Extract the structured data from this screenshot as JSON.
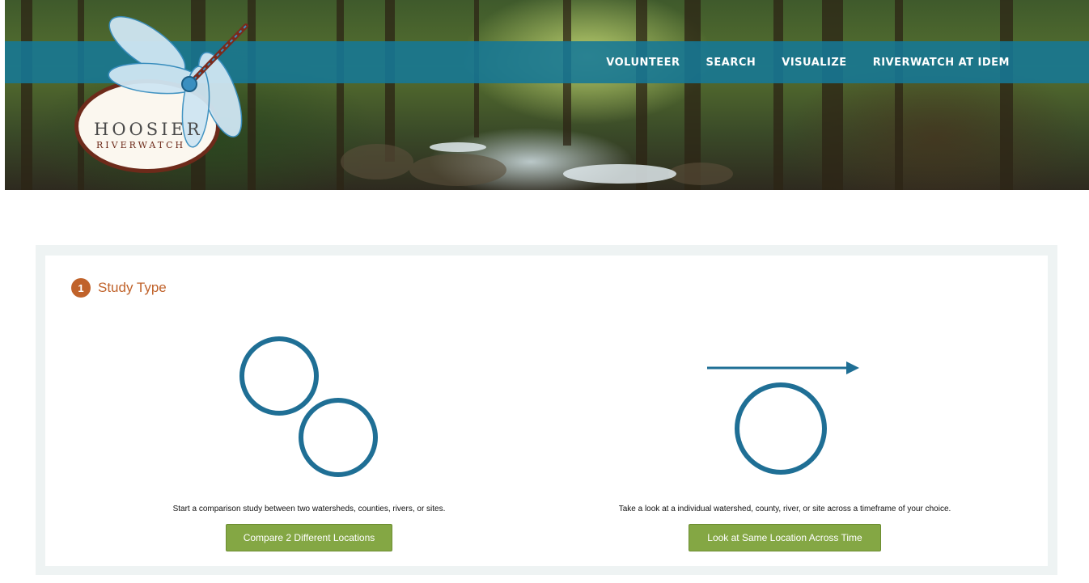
{
  "header": {
    "logo": {
      "line1": "HOOSIER",
      "line2": "RIVERWATCH"
    },
    "nav": [
      "VOLUNTEER",
      "SEARCH",
      "VISUALIZE",
      "RIVERWATCH AT IDEM"
    ]
  },
  "study": {
    "step_number": "1",
    "title": "Study Type",
    "options": [
      {
        "icon": "two-circles-icon",
        "description": "Start a comparison study between two watersheds, counties, rivers, or sites.",
        "button": "Compare 2 Different Locations"
      },
      {
        "icon": "circle-timeline-icon",
        "description": "Take a look at a individual watershed, county, river, or site across a timeframe of your choice.",
        "button": "Look at Same Location Across Time"
      }
    ]
  },
  "colors": {
    "nav_bar": "#16789a",
    "accent_orange": "#c0622a",
    "button_green": "#84a744",
    "icon_blue": "#1f6f95"
  }
}
